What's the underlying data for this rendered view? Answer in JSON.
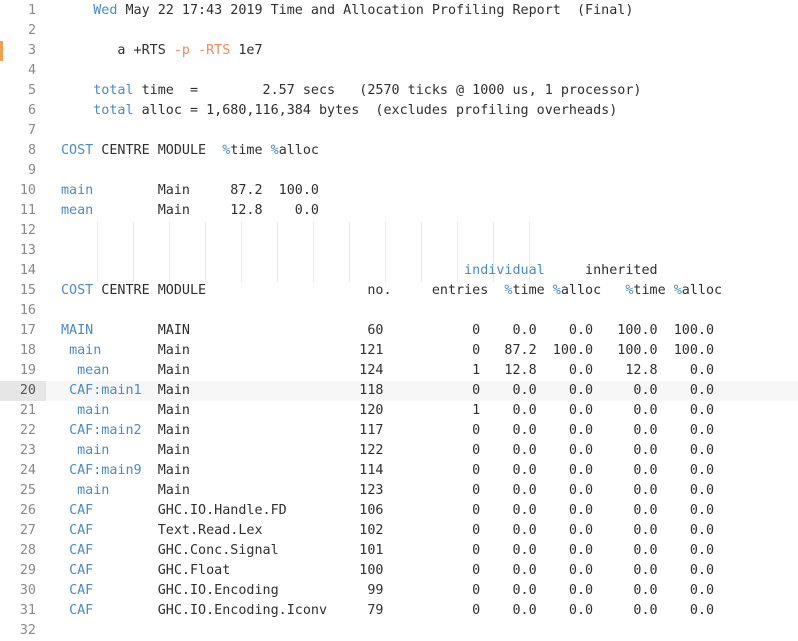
{
  "file": {
    "lines": [
      {
        "n": "1",
        "parts": [
          {
            "t": "    "
          },
          {
            "t": "Wed",
            "c": "kw"
          },
          {
            "t": " May 22 17:43 2019 Time and Allocation Profiling Report  (Final)"
          }
        ]
      },
      {
        "n": "2",
        "parts": []
      },
      {
        "n": "3",
        "parts": [
          {
            "t": "       a +RTS "
          },
          {
            "t": "-p",
            "c": "rts"
          },
          {
            "t": " "
          },
          {
            "t": "-RTS",
            "c": "rts"
          },
          {
            "t": " 1e7"
          }
        ],
        "modified": true
      },
      {
        "n": "4",
        "parts": []
      },
      {
        "n": "5",
        "parts": [
          {
            "t": "    "
          },
          {
            "t": "total",
            "c": "kw"
          },
          {
            "t": " time  =        2.57 secs   (2570 ticks @ 1000 us, 1 processor)"
          }
        ]
      },
      {
        "n": "6",
        "parts": [
          {
            "t": "    "
          },
          {
            "t": "total",
            "c": "kw"
          },
          {
            "t": " alloc = 1,680,116,384 bytes  (excludes profiling overheads)"
          }
        ]
      },
      {
        "n": "7",
        "parts": []
      },
      {
        "n": "8",
        "parts": [
          {
            "t": "COST",
            "c": "kw"
          },
          {
            "t": " CENTRE MODULE  "
          },
          {
            "t": "%",
            "c": "kw"
          },
          {
            "t": "time "
          },
          {
            "t": "%",
            "c": "kw"
          },
          {
            "t": "alloc"
          }
        ]
      },
      {
        "n": "9",
        "parts": []
      },
      {
        "n": "10",
        "parts": [
          {
            "t": "main",
            "c": "kw"
          },
          {
            "t": "        Main     87.2  100.0"
          }
        ]
      },
      {
        "n": "11",
        "parts": [
          {
            "t": "mean",
            "c": "kw"
          },
          {
            "t": "        Main     12.8    0.0"
          }
        ]
      },
      {
        "n": "12",
        "parts": []
      },
      {
        "n": "13",
        "parts": []
      },
      {
        "n": "14",
        "parts": [
          {
            "t": "                                                  "
          },
          {
            "t": "individual",
            "c": "kw"
          },
          {
            "t": "     inherited"
          }
        ]
      },
      {
        "n": "15",
        "parts": [
          {
            "t": "COST",
            "c": "kw"
          },
          {
            "t": " CENTRE MODULE                    no.     entries  "
          },
          {
            "t": "%",
            "c": "kw"
          },
          {
            "t": "time "
          },
          {
            "t": "%",
            "c": "kw"
          },
          {
            "t": "alloc   "
          },
          {
            "t": "%",
            "c": "kw"
          },
          {
            "t": "time "
          },
          {
            "t": "%",
            "c": "kw"
          },
          {
            "t": "alloc"
          }
        ]
      },
      {
        "n": "16",
        "parts": []
      },
      {
        "n": "17",
        "parts": [
          {
            "t": "MAIN",
            "c": "kw"
          },
          {
            "t": "        MAIN                      60           0    0.0    0.0   100.0  100.0"
          }
        ]
      },
      {
        "n": "18",
        "parts": [
          {
            "t": " "
          },
          {
            "t": "main",
            "c": "kw"
          },
          {
            "t": "       Main                     121           0   87.2  100.0   100.0  100.0"
          }
        ]
      },
      {
        "n": "19",
        "parts": [
          {
            "t": "  "
          },
          {
            "t": "mean",
            "c": "kw"
          },
          {
            "t": "      Main                     124           1   12.8    0.0    12.8    0.0"
          }
        ]
      },
      {
        "n": "20",
        "parts": [
          {
            "t": " "
          },
          {
            "t": "CAF:main1",
            "c": "kw"
          },
          {
            "t": "  Main                     118           0    0.0    0.0     0.0    0.0"
          }
        ],
        "current": true
      },
      {
        "n": "21",
        "parts": [
          {
            "t": "  "
          },
          {
            "t": "main",
            "c": "kw"
          },
          {
            "t": "      Main                     120           1    0.0    0.0     0.0    0.0"
          }
        ]
      },
      {
        "n": "22",
        "parts": [
          {
            "t": " "
          },
          {
            "t": "CAF:main2",
            "c": "kw"
          },
          {
            "t": "  Main                     117           0    0.0    0.0     0.0    0.0"
          }
        ]
      },
      {
        "n": "23",
        "parts": [
          {
            "t": "  "
          },
          {
            "t": "main",
            "c": "kw"
          },
          {
            "t": "      Main                     122           0    0.0    0.0     0.0    0.0"
          }
        ]
      },
      {
        "n": "24",
        "parts": [
          {
            "t": " "
          },
          {
            "t": "CAF:main9",
            "c": "kw"
          },
          {
            "t": "  Main                     114           0    0.0    0.0     0.0    0.0"
          }
        ]
      },
      {
        "n": "25",
        "parts": [
          {
            "t": "  "
          },
          {
            "t": "main",
            "c": "kw"
          },
          {
            "t": "      Main                     123           0    0.0    0.0     0.0    0.0"
          }
        ]
      },
      {
        "n": "26",
        "parts": [
          {
            "t": " "
          },
          {
            "t": "CAF",
            "c": "kw"
          },
          {
            "t": "        GHC.IO.Handle.FD         106           0    0.0    0.0     0.0    0.0"
          }
        ]
      },
      {
        "n": "27",
        "parts": [
          {
            "t": " "
          },
          {
            "t": "CAF",
            "c": "kw"
          },
          {
            "t": "        Text.Read.Lex            102           0    0.0    0.0     0.0    0.0"
          }
        ]
      },
      {
        "n": "28",
        "parts": [
          {
            "t": " "
          },
          {
            "t": "CAF",
            "c": "kw"
          },
          {
            "t": "        GHC.Conc.Signal          101           0    0.0    0.0     0.0    0.0"
          }
        ]
      },
      {
        "n": "29",
        "parts": [
          {
            "t": " "
          },
          {
            "t": "CAF",
            "c": "kw"
          },
          {
            "t": "        GHC.Float                100           0    0.0    0.0     0.0    0.0"
          }
        ]
      },
      {
        "n": "30",
        "parts": [
          {
            "t": " "
          },
          {
            "t": "CAF",
            "c": "kw"
          },
          {
            "t": "        GHC.IO.Encoding           99           0    0.0    0.0     0.0    0.0"
          }
        ]
      },
      {
        "n": "31",
        "parts": [
          {
            "t": " "
          },
          {
            "t": "CAF",
            "c": "kw"
          },
          {
            "t": "        GHC.IO.Encoding.Iconv     79           0    0.0    0.0     0.0    0.0"
          }
        ]
      },
      {
        "n": "32",
        "parts": []
      }
    ]
  }
}
